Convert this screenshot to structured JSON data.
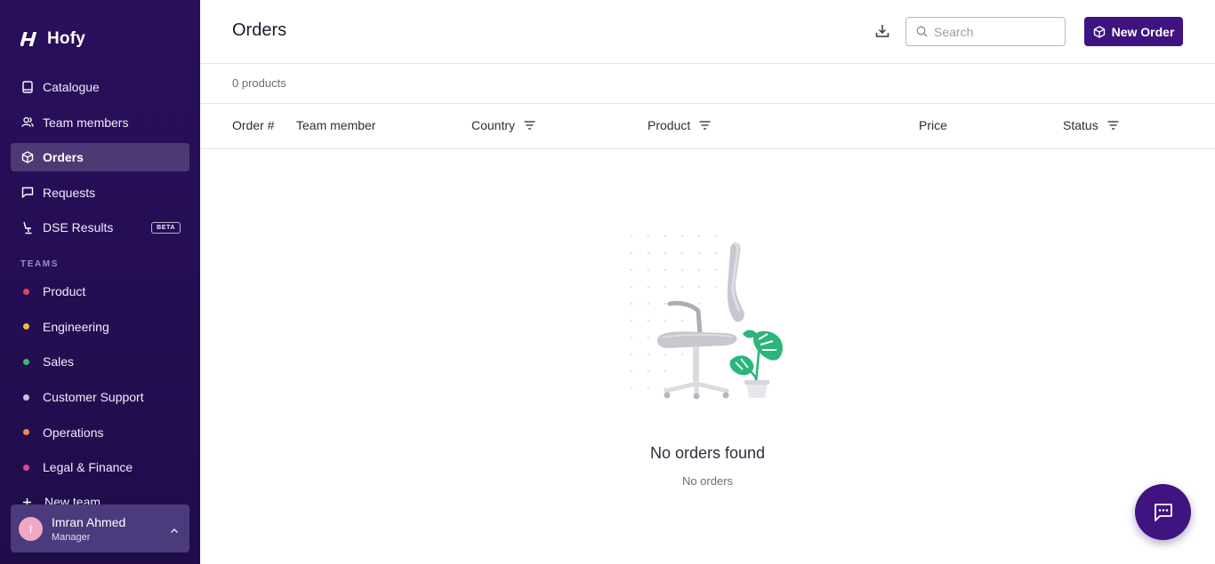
{
  "brand": {
    "name": "Hofy"
  },
  "nav": [
    {
      "label": "Catalogue",
      "icon": "book-icon"
    },
    {
      "label": "Team members",
      "icon": "users-icon"
    },
    {
      "label": "Orders",
      "icon": "box-icon",
      "active": true
    },
    {
      "label": "Requests",
      "icon": "message-icon"
    },
    {
      "label": "DSE Results",
      "icon": "chair-icon",
      "badge": "BETA"
    }
  ],
  "teams": {
    "label": "TEAMS",
    "items": [
      {
        "label": "Product",
        "color": "#e0445a"
      },
      {
        "label": "Engineering",
        "color": "#f5b942"
      },
      {
        "label": "Sales",
        "color": "#2fbf71"
      },
      {
        "label": "Customer Support",
        "color": "#c9c4d8"
      },
      {
        "label": "Operations",
        "color": "#f08a3c"
      },
      {
        "label": "Legal & Finance",
        "color": "#e0449a"
      }
    ],
    "new_team": "New team"
  },
  "user": {
    "initial": "I",
    "name": "Imran Ahmed",
    "role": "Manager"
  },
  "header": {
    "title": "Orders",
    "search_placeholder": "Search",
    "new_order_label": "New Order"
  },
  "summary": {
    "count_text": "0 products"
  },
  "table": {
    "columns": [
      {
        "label": "Order #",
        "filter": false
      },
      {
        "label": "Team member",
        "filter": false
      },
      {
        "label": "Country",
        "filter": true
      },
      {
        "label": "Product",
        "filter": true
      },
      {
        "label": "Price",
        "filter": false
      },
      {
        "label": "Status",
        "filter": true
      }
    ]
  },
  "empty": {
    "title": "No orders found",
    "subtitle": "No orders"
  },
  "colors": {
    "sidebar": "#2a0f5c",
    "primary": "#3f1380",
    "plant": "#2bb57b"
  }
}
